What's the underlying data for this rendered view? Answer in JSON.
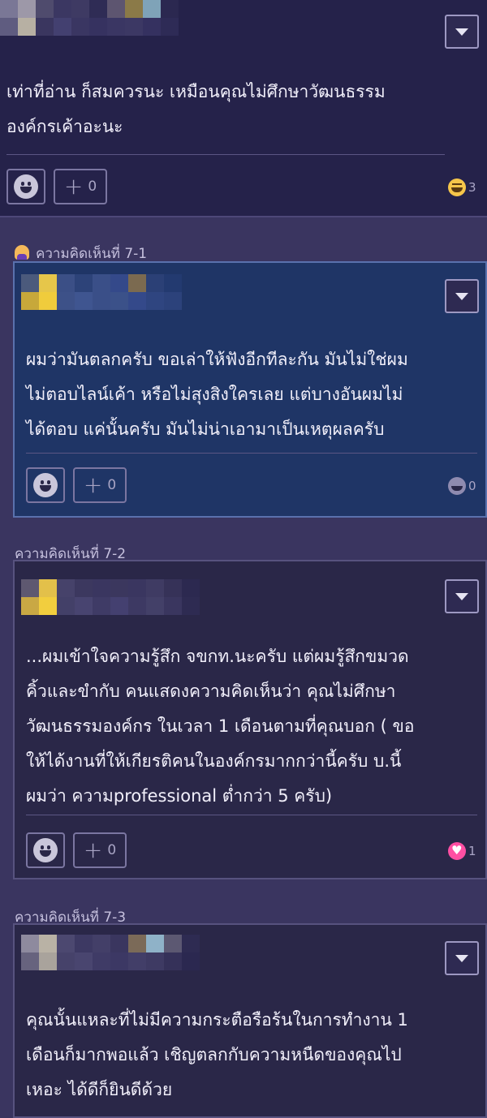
{
  "top_comment": {
    "text": "เท่าที่อ่าน ก็สมควรนะ เหมือนคุณไม่ศึกษาวัฒนธรรม\nองค์กรเค้าอะนะ",
    "plus_count": "0",
    "reaction_count": "3"
  },
  "replies": [
    {
      "label": "ความคิดเห็นที่ 7-1",
      "text": "ผมว่ามันตลกครับ ขอเล่าให้ฟังอีกทีละกัน มันไม่ใช่ผม\nไม่ตอบไลน์เค้า หรือไม่สุงสิงใครเลย แต่บางอันผมไม่\nได้ตอบ แค่นั้นครับ มันไม่น่าเอามาเป็นเหตุผลครับ",
      "plus_count": "0",
      "reaction_count": "0"
    },
    {
      "label": "ความคิดเห็นที่ 7-2",
      "text": "...ผมเข้าใจความรู้สึก จขกท.นะครับ แต่ผมรู้สึกขมวด\nคิ้วและขำกับ คนแสดงความคิดเห็นว่า คุณไม่ศึกษา\nวัฒนธรรมองค์กร ในเวลา 1 เดือนตามที่คุณบอก ( ขอ\nให้ได้งานที่ให้เกียรติคนในองค์กรมากกว่านี้ครับ บ.นี้\nผมว่า ความprofessional ต่ำกว่า 5 ครับ)",
      "plus_count": "0",
      "reaction_count": "1"
    },
    {
      "label": "ความคิดเห็นที่ 7-3",
      "text": "คุณนั้นแหละที่ไม่มีความกระตือรือร้นในการทำงาน 1\nเดือนก็มากพอแล้ว เชิญตลกกับความหนืดของคุณไป\nเหอะ ได้ดีก็ยินดีด้วย"
    }
  ],
  "icons": {
    "dropdown": "chevron-down-icon",
    "emoji_button": "smiley-icon",
    "plus": "plus-icon",
    "reaction_laugh": "laughing-emoji-icon",
    "reaction_heart": "heart-emoji-icon",
    "author_badge": "person-icon"
  },
  "colors": {
    "page_bg": "#3a3560",
    "card_bg": "#2a2748",
    "highlight_card_bg": "#1f3566",
    "heart": "#ff4fa3",
    "laugh": "#f6c64a"
  }
}
